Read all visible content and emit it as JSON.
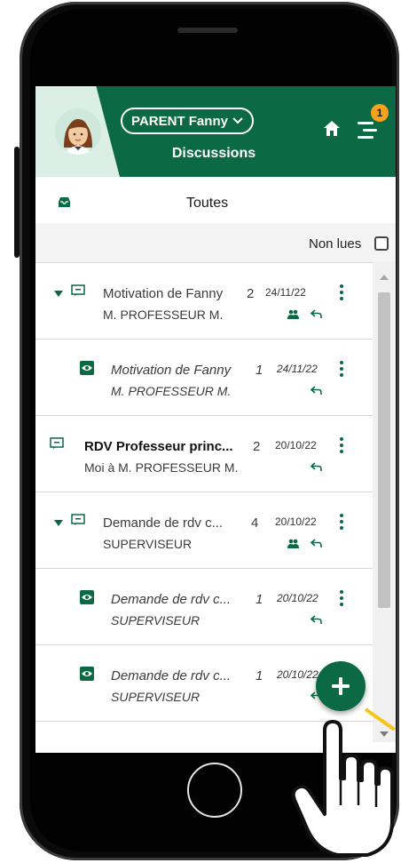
{
  "header": {
    "user_label": "PARENT Fanny",
    "title": "Discussions",
    "notification_count": "1",
    "colors": {
      "primary": "#0b6a44",
      "accent": "#f6a21a",
      "light": "#dcefe6"
    }
  },
  "folder": {
    "title": "Toutes"
  },
  "filter": {
    "label": "Non lues",
    "checked": false
  },
  "rows": [
    {
      "subject": "Motivation de Fanny",
      "count": "2",
      "sender": "M. PROFESSEUR M.",
      "date": "24/11/22"
    },
    {
      "subject": "Motivation de Fanny",
      "count": "1",
      "sender": "M. PROFESSEUR M.",
      "date": "24/11/22"
    },
    {
      "subject": "RDV Professeur princ...",
      "count": "2",
      "sender": "Moi à M. PROFESSEUR M.",
      "date": "20/10/22"
    },
    {
      "subject": "Demande de rdv c...",
      "count": "4",
      "sender": "SUPERVISEUR",
      "date": "20/10/22"
    },
    {
      "subject": "Demande de rdv c...",
      "count": "1",
      "sender": "SUPERVISEUR",
      "date": "20/10/22"
    },
    {
      "subject": "Demande de rdv c...",
      "count": "1",
      "sender": "SUPERVISEUR",
      "date": "20/10/22"
    }
  ]
}
